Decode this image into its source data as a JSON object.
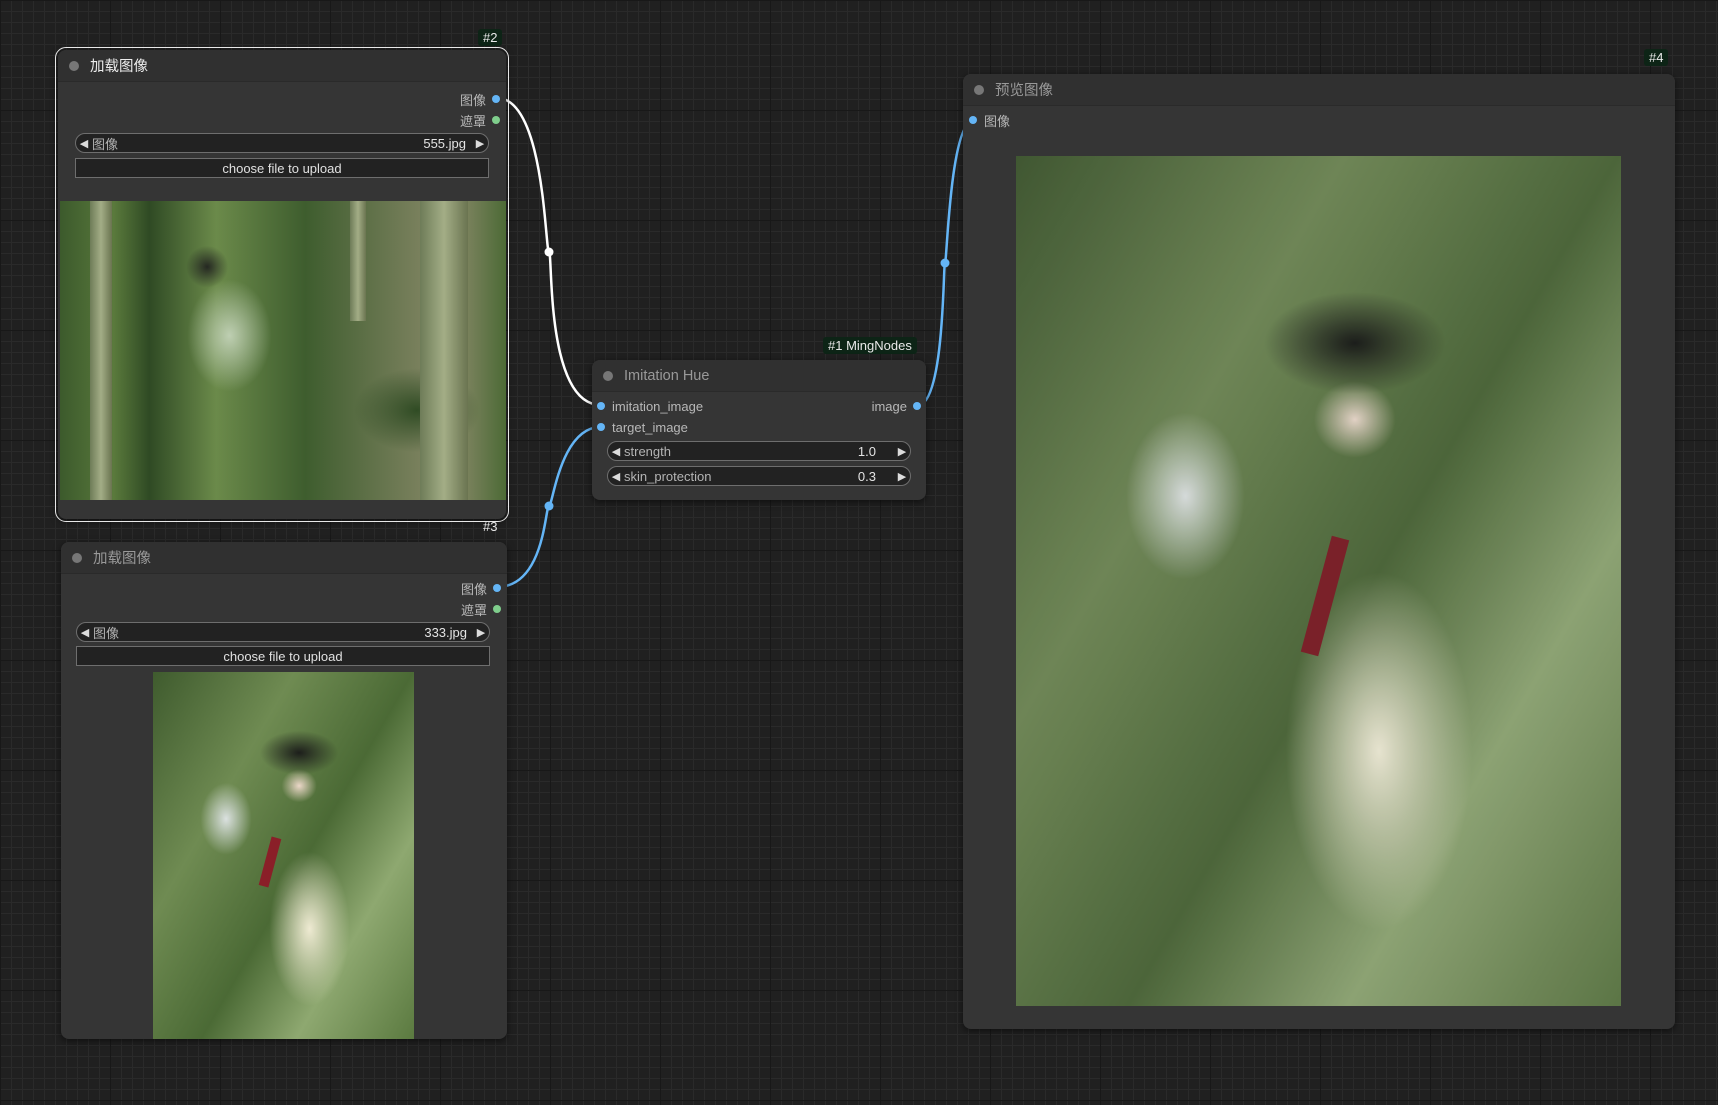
{
  "nodes": {
    "load_image_1": {
      "id_badge": "#2",
      "title": "加载图像",
      "outputs": [
        "图像",
        "遮罩"
      ],
      "widget": {
        "label": "图像",
        "value": "555.jpg"
      },
      "upload_label": "choose file to upload"
    },
    "load_image_2": {
      "id_badge": "#3",
      "title": "加载图像",
      "outputs": [
        "图像",
        "遮罩"
      ],
      "widget": {
        "label": "图像",
        "value": "333.jpg"
      },
      "upload_label": "choose file to upload"
    },
    "imitation_hue": {
      "id_badge": "#1 MingNodes",
      "title": "Imitation Hue",
      "inputs": [
        "imitation_image",
        "target_image"
      ],
      "outputs": [
        "image"
      ],
      "widgets": [
        {
          "label": "strength",
          "value": "1.0"
        },
        {
          "label": "skin_protection",
          "value": "0.3"
        }
      ]
    },
    "preview_image": {
      "id_badge": "#4",
      "title": "预览图像",
      "inputs": [
        "图像"
      ]
    }
  },
  "colors": {
    "image_slot": "#64b5f6",
    "mask_slot": "#7fce8c",
    "selected_link": "#ffffff",
    "image_link": "#64b5f6",
    "badge_bg": "#0d2416"
  }
}
